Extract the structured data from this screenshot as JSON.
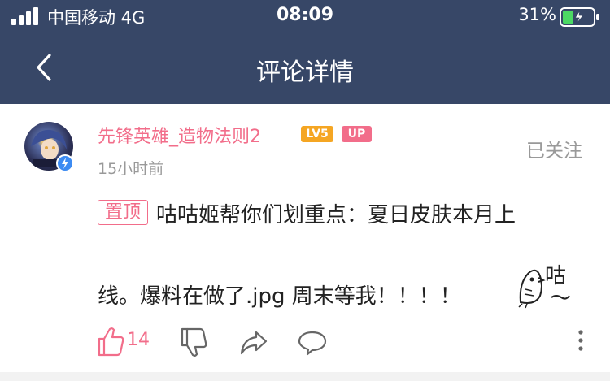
{
  "status_bar": {
    "carrier": "中国移动  4G",
    "time": "08:09",
    "battery_percent": "31%",
    "battery_level": 0.31
  },
  "nav": {
    "title": "评论详情",
    "back_icon": "chevron-left-icon"
  },
  "comment": {
    "author": "先锋英雄_造物法则2",
    "level_badge": "LV5",
    "up_badge": "UP",
    "time_ago": "15小时前",
    "follow_label": "已关注",
    "pin_label": "置顶",
    "text_line1": "咕咕姬帮你们划重点：夏日皮肤本月上",
    "text_line2": "线。爆料在做了.jpg 周末等我！！！！",
    "sticker_text": "咕"
  },
  "actions": {
    "like_count": "14",
    "like_icon": "thumbs-up-icon",
    "dislike_icon": "thumbs-down-icon",
    "share_icon": "share-icon",
    "reply_icon": "comment-icon",
    "more_icon": "more-vertical-icon"
  },
  "colors": {
    "nav_bg": "#374767",
    "accent_pink": "#f26d8a",
    "level_orange": "#f5a623",
    "muted_text": "#999999"
  }
}
